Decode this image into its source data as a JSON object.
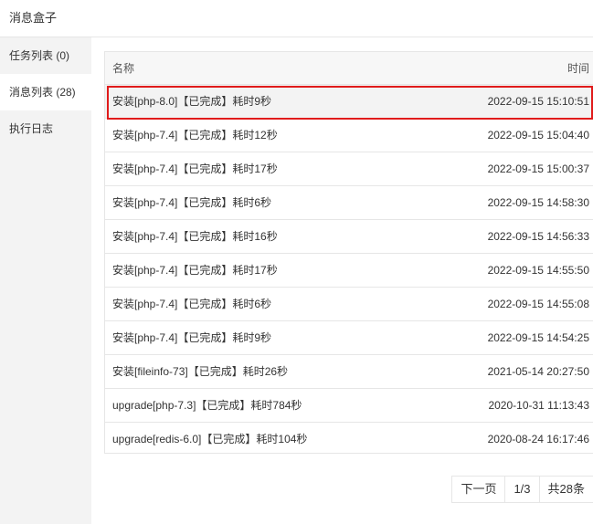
{
  "window": {
    "title": "消息盒子"
  },
  "sidebar": {
    "items": [
      {
        "label": "任务列表 (0)"
      },
      {
        "label": "消息列表 (28)"
      },
      {
        "label": "执行日志"
      }
    ]
  },
  "table": {
    "headers": {
      "name": "名称",
      "time": "时间"
    },
    "rows": [
      {
        "name": "安装[php-8.0]【已完成】耗时9秒",
        "time": "2022-09-15 15:10:51"
      },
      {
        "name": "安装[php-7.4]【已完成】耗时12秒",
        "time": "2022-09-15 15:04:40"
      },
      {
        "name": "安装[php-7.4]【已完成】耗时17秒",
        "time": "2022-09-15 15:00:37"
      },
      {
        "name": "安装[php-7.4]【已完成】耗时6秒",
        "time": "2022-09-15 14:58:30"
      },
      {
        "name": "安装[php-7.4]【已完成】耗时16秒",
        "time": "2022-09-15 14:56:33"
      },
      {
        "name": "安装[php-7.4]【已完成】耗时17秒",
        "time": "2022-09-15 14:55:50"
      },
      {
        "name": "安装[php-7.4]【已完成】耗时6秒",
        "time": "2022-09-15 14:55:08"
      },
      {
        "name": "安装[php-7.4]【已完成】耗时9秒",
        "time": "2022-09-15 14:54:25"
      },
      {
        "name": "安装[fileinfo-73]【已完成】耗时26秒",
        "time": "2021-05-14 20:27:50"
      },
      {
        "name": "upgrade[php-7.3]【已完成】耗时784秒",
        "time": "2020-10-31 11:13:43"
      },
      {
        "name": "upgrade[redis-6.0]【已完成】耗时104秒",
        "time": "2020-08-24 16:17:46"
      }
    ]
  },
  "pager": {
    "next_label": "下一页",
    "page_indicator": "1/3",
    "total_label": "共28条"
  },
  "colors": {
    "highlight_border": "#e01b1b",
    "sidebar_bg": "#f3f3f3"
  }
}
